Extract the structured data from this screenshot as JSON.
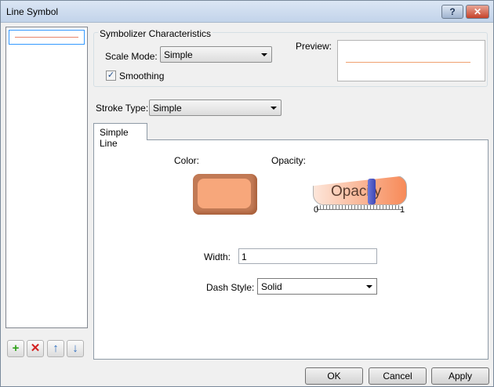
{
  "window": {
    "title": "Line Symbol",
    "help_label": "?",
    "close_label": "✕"
  },
  "symbol_list": {
    "items": [
      {
        "type": "simple-line",
        "color": "#e8856a"
      }
    ]
  },
  "list_buttons": {
    "add": "+",
    "remove": "✕",
    "up": "↑",
    "down": "↓"
  },
  "symbolizer": {
    "group_title": "Symbolizer Characteristics",
    "scale_mode_label": "Scale Mode:",
    "scale_mode_value": "Simple",
    "smoothing_label": "Smoothing",
    "smoothing_checked": true,
    "smoothing_check_glyph": "✓",
    "preview_label": "Preview:"
  },
  "stroke": {
    "label": "Stroke Type:",
    "value": "Simple"
  },
  "tabs": [
    {
      "label": "Simple Line",
      "active": true
    }
  ],
  "simple_line": {
    "color_label": "Color:",
    "color_value": "#f7a77b",
    "opacity_label": "Opacity:",
    "opacity_text": "Opacity",
    "opacity_value": 0.65,
    "opacity_min": "0",
    "opacity_max": "1",
    "width_label": "Width:",
    "width_value": "1",
    "dash_label": "Dash Style:",
    "dash_value": "Solid"
  },
  "footer": {
    "ok": "OK",
    "cancel": "Cancel",
    "apply": "Apply"
  }
}
